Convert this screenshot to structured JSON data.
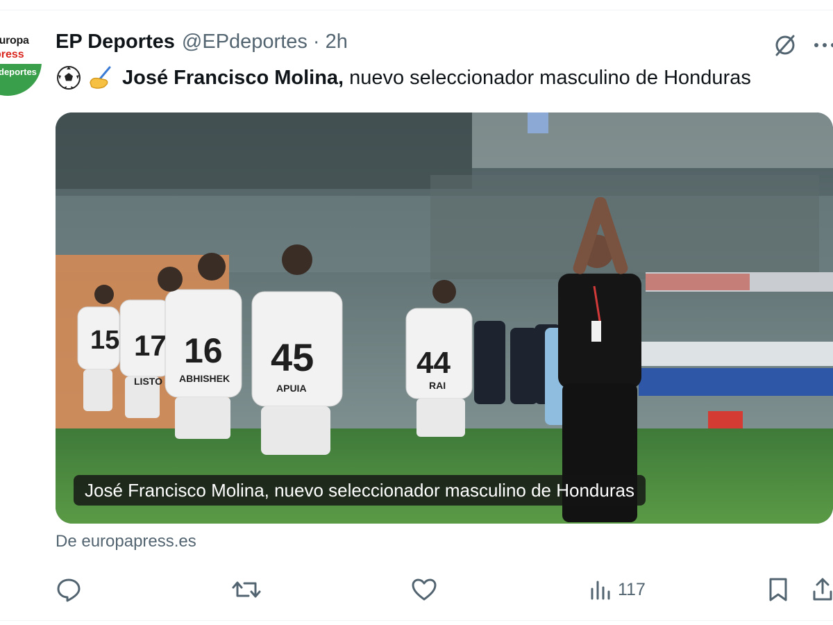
{
  "tweet": {
    "avatar": {
      "line1": "europa",
      "line2": "press",
      "line3": "deportes"
    },
    "author_name": "EP Deportes",
    "handle": "@EPdeportes",
    "separator": "·",
    "time": "2h",
    "text_bold": "José Francisco Molina,",
    "text_rest": "nuevo seleccionador masculino de Honduras",
    "emojis": [
      "soccer-ball-icon",
      "writing-hand-icon"
    ],
    "media": {
      "caption": "José Francisco Molina, nuevo seleccionador masculino de Honduras",
      "description_players": [
        "15",
        "17",
        "16",
        "45",
        "44"
      ],
      "player_names": [
        "LISTO",
        "ABHISHEK",
        "APUIA",
        "RAI"
      ]
    },
    "source": "De europapress.es",
    "actions": {
      "reply_icon": "reply-icon",
      "repost_icon": "repost-icon",
      "like_icon": "heart-icon",
      "views_icon": "views-chart-icon",
      "views_count": "117",
      "bookmark_icon": "bookmark-icon",
      "share_icon": "share-icon"
    },
    "header_icons": [
      "grok-icon",
      "more-icon"
    ]
  },
  "colors": {
    "text_primary": "#0f1419",
    "text_secondary": "#536471",
    "divider": "#eff3f4",
    "caption_bg": "#141414"
  }
}
